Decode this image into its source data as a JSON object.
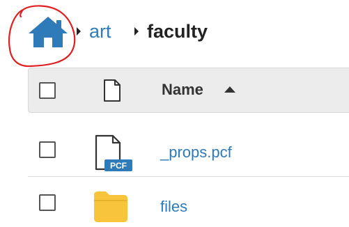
{
  "breadcrumb": {
    "home_icon": "home-icon",
    "items": [
      {
        "label": "art",
        "link": true
      },
      {
        "label": "faculty",
        "link": false
      }
    ]
  },
  "table": {
    "columns": {
      "select_all": "checkbox",
      "type_icon": "file-icon",
      "name_label": "Name",
      "sort": "ascending"
    },
    "rows": [
      {
        "name": "_props.pcf",
        "icon": "pcf-file-icon",
        "icon_badge": "PCF"
      },
      {
        "name": "files",
        "icon": "folder-icon"
      }
    ]
  },
  "colors": {
    "link": "#2f7ab8",
    "home": "#2f7ab8",
    "header_bg": "#ececec",
    "annotation": "#e02020",
    "folder": "#f8c43b"
  }
}
